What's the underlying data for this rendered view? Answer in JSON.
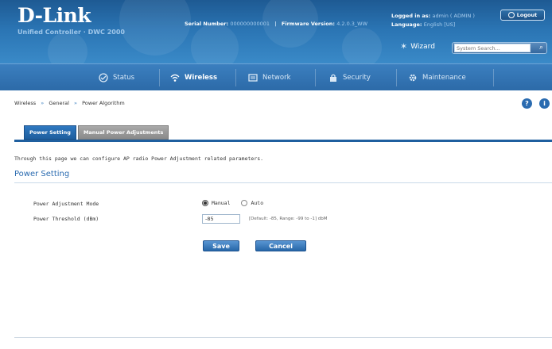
{
  "header": {
    "brand": "D-Link",
    "subtitle": "Unified Controller · DWC 2000",
    "serial_label": "Serial Number:",
    "serial_value": "000000000001",
    "firmware_label": "Firmware Version:",
    "firmware_value": "4.2.0.3_WW",
    "logged_label": "Logged in as:",
    "logged_value": "admin ( ADMIN )",
    "language_label": "Language:",
    "language_value": "English [US]",
    "logout_label": "Logout",
    "wizard_label": "Wizard",
    "search_placeholder": "System Search..."
  },
  "nav": {
    "items": [
      {
        "label": "Status",
        "icon": "status-icon"
      },
      {
        "label": "Wireless",
        "icon": "wifi-icon"
      },
      {
        "label": "Network",
        "icon": "network-icon"
      },
      {
        "label": "Security",
        "icon": "lock-icon"
      },
      {
        "label": "Maintenance",
        "icon": "gear-icon"
      }
    ],
    "active": "Wireless"
  },
  "breadcrumb": [
    "Wireless",
    "General",
    "Power Algorithm"
  ],
  "tabs": [
    {
      "label": "Power Setting",
      "active": true
    },
    {
      "label": "Manual Power Adjustments",
      "active": false
    }
  ],
  "description": "Through this page we can configure AP radio Power Adjustment related parameters.",
  "section_title": "Power Setting",
  "form": {
    "mode_label": "Power Adjustment Mode",
    "mode_options": [
      "Manual",
      "Auto"
    ],
    "mode_selected": "Manual",
    "threshold_label": "Power Threshold (dBm)",
    "threshold_value": "-85",
    "threshold_hint": "[Default: -85, Range: -99 to -1] dbM"
  },
  "buttons": {
    "save": "Save",
    "cancel": "Cancel"
  },
  "colors": {
    "header": "#2a74b3",
    "nav": "#3b7fbf",
    "accent": "#2a6bb0"
  }
}
